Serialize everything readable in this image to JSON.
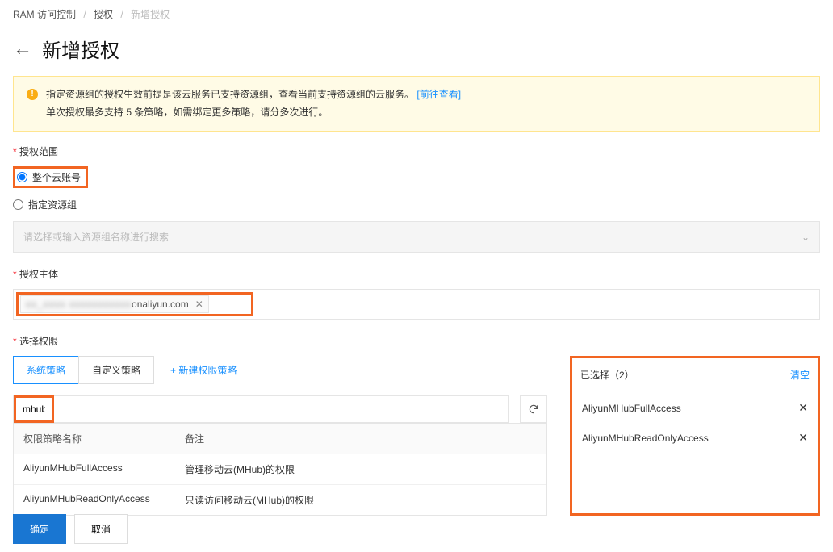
{
  "breadcrumb": {
    "item1": "RAM 访问控制",
    "item2": "授权",
    "item3": "新增授权"
  },
  "page_title": "新增授权",
  "info": {
    "line1_pre": "指定资源组的授权生效前提是该云服务已支持资源组，查看当前支持资源组的云服务。",
    "link": "[前往查看]",
    "line2": "单次授权最多支持 5 条策略，如需绑定更多策略，请分多次进行。"
  },
  "scope": {
    "label": "授权范围",
    "whole_account": "整个云账号",
    "resource_group": "指定资源组",
    "rg_placeholder": "请选择或输入资源组名称进行搜索"
  },
  "principal": {
    "label": "授权主体",
    "value_prefix": "xx_xxxx  xxxxxxxxxxx",
    "value_suffix": "onaliyun.com"
  },
  "policy": {
    "label": "选择权限",
    "tab_system": "系统策略",
    "tab_custom": "自定义策略",
    "new_link": "+ 新建权限策略",
    "search_value": "mhub",
    "table": {
      "col_name": "权限策略名称",
      "col_remark": "备注",
      "rows": [
        {
          "name": "AliyunMHubFullAccess",
          "remark": "管理移动云(MHub)的权限"
        },
        {
          "name": "AliyunMHubReadOnlyAccess",
          "remark": "只读访问移动云(MHub)的权限"
        }
      ]
    }
  },
  "selected": {
    "heading": "已选择（2）",
    "clear": "清空",
    "items": [
      "AliyunMHubFullAccess",
      "AliyunMHubReadOnlyAccess"
    ]
  },
  "footer": {
    "ok": "确定",
    "cancel": "取消"
  }
}
